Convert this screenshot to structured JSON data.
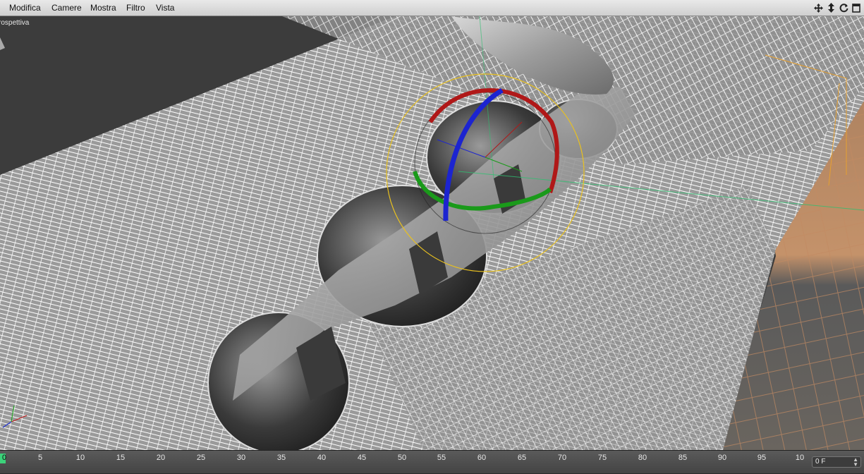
{
  "menu": {
    "items": [
      {
        "name": "menu-modifica",
        "label": "Modifica"
      },
      {
        "name": "menu-camere",
        "label": "Camere"
      },
      {
        "name": "menu-mostra",
        "label": "Mostra"
      },
      {
        "name": "menu-filtro",
        "label": "Filtro"
      },
      {
        "name": "menu-vista",
        "label": "Vista"
      }
    ]
  },
  "nav_icons": [
    "move-view-icon",
    "dolly-view-icon",
    "rotate-view-icon",
    "maximize-view-icon"
  ],
  "viewport": {
    "label": "rospettiva",
    "gizmo_colors": {
      "x": "#b01818",
      "y": "#1a9a1a",
      "z": "#1c24d0",
      "bounding": "#e8c020"
    }
  },
  "timeline": {
    "ticks": [
      "0",
      "5",
      "10",
      "15",
      "20",
      "25",
      "30",
      "35",
      "40",
      "45",
      "50",
      "55",
      "60",
      "65",
      "70",
      "75",
      "80",
      "85",
      "90",
      "95",
      "10"
    ],
    "current_frame": "0 F",
    "playhead_color": "#3cd27a"
  }
}
